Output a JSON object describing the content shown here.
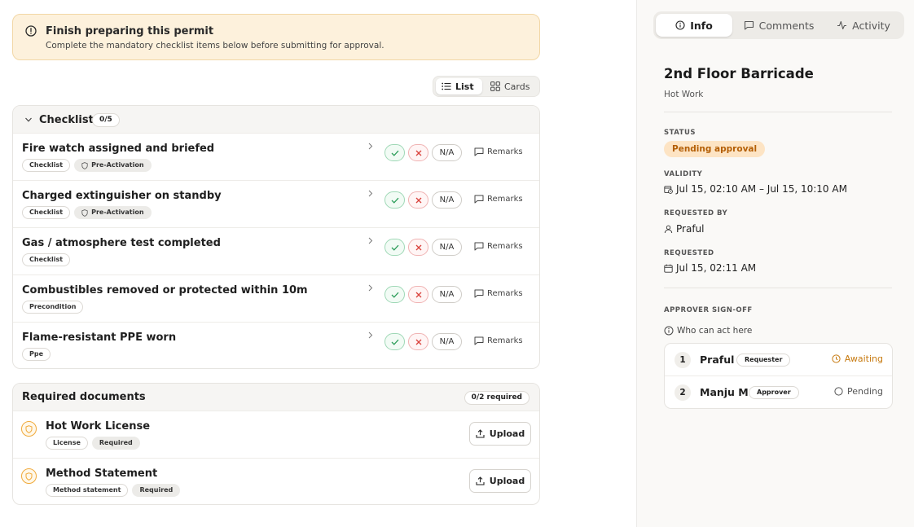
{
  "banner": {
    "title": "Finish preparing this permit",
    "subtitle": "Complete the mandatory checklist items below before submitting for approval."
  },
  "view_toggle": {
    "list": "List",
    "cards": "Cards",
    "selected": "List"
  },
  "checklist": {
    "title": "Checklist",
    "count": "0/5",
    "action_na": "N/A",
    "action_remarks": "Remarks",
    "items": [
      {
        "title": "Fire watch assigned and briefed",
        "tags": [
          "Checklist",
          "Pre-Activation"
        ]
      },
      {
        "title": "Charged extinguisher on standby",
        "tags": [
          "Checklist",
          "Pre-Activation"
        ]
      },
      {
        "title": "Gas / atmosphere test completed",
        "tags": [
          "Checklist"
        ]
      },
      {
        "title": "Combustibles removed or protected within 10m",
        "tags": [
          "Precondition"
        ]
      },
      {
        "title": "Flame-resistant PPE worn",
        "tags": [
          "Ppe"
        ]
      }
    ]
  },
  "documents": {
    "title": "Required documents",
    "count": "0/2 required",
    "upload_label": "Upload",
    "items": [
      {
        "name": "Hot Work License",
        "tags": [
          "License",
          "Required"
        ]
      },
      {
        "name": "Method Statement",
        "tags": [
          "Method statement",
          "Required"
        ]
      }
    ]
  },
  "sidebar": {
    "tabs": [
      {
        "label": "Info",
        "icon": "info-icon"
      },
      {
        "label": "Comments",
        "icon": "comment-icon"
      },
      {
        "label": "Activity",
        "icon": "activity-icon"
      }
    ],
    "title": "2nd Floor Barricade",
    "subtitle": "Hot Work",
    "status_label": "STATUS",
    "status_value": "Pending approval",
    "validity_label": "VALIDITY",
    "validity_value": "Jul 15, 02:10 AM – Jul 15, 10:10 AM",
    "requested_by_label": "REQUESTED BY",
    "requested_by_value": "Praful",
    "requested_label": "REQUESTED",
    "requested_value": "Jul 15, 02:11 AM",
    "signoff_label": "APPROVER SIGN-OFF",
    "who_can_act": "Who can act here",
    "approvers": [
      {
        "num": "1",
        "name": "Praful",
        "role": "Requester",
        "state": "Awaiting"
      },
      {
        "num": "2",
        "name": "Manju M",
        "role": "Approver",
        "state": "Pending"
      }
    ]
  },
  "colors": {
    "accent_amber": "#f0a93a",
    "ok_green": "#2e9e5b",
    "reject_red": "#d9443f",
    "status_text": "#b45f06"
  }
}
